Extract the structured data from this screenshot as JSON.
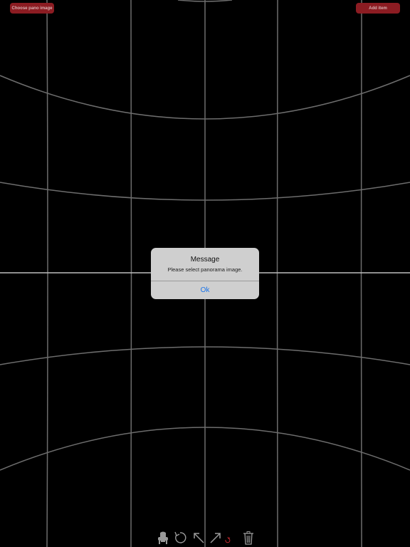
{
  "top_bar": {
    "choose_label": "Choose pano image",
    "add_label": "Add item"
  },
  "alert": {
    "title": "Message",
    "message": "Please select panorama image.",
    "ok_label": "Ok"
  },
  "toolbar": {
    "icons": [
      "chair-icon",
      "rotate-icon",
      "arrow-up-left-icon",
      "arrow-up-right-icon",
      "trash-icon"
    ]
  },
  "colors": {
    "background": "#000000",
    "grid": "#6f6f6f",
    "button_bg": "#8c1c22",
    "alert_bg": "#cfcfcf",
    "ok_text": "#1a73e8",
    "accent_red": "#c0282e"
  }
}
